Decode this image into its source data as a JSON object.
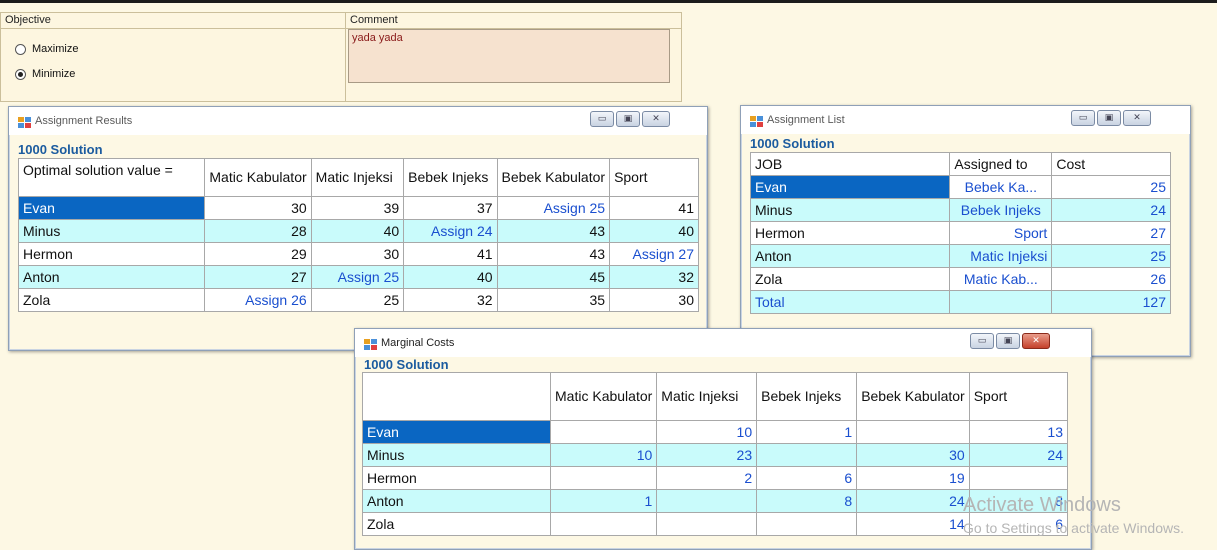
{
  "objective": {
    "label": "Objective",
    "maximize": "Maximize",
    "minimize": "Minimize",
    "selected": "minimize"
  },
  "comment": {
    "label": "Comment",
    "value": "yada yada"
  },
  "assignment_results": {
    "title": "Assignment Results",
    "solution": "1000 Solution",
    "corner": "Optimal solution value =",
    "columns": [
      "Matic Kabulator",
      "Matic Injeksi",
      "Bebek Injeks",
      "Bebek Kabulator",
      "Sport"
    ],
    "rows": [
      {
        "name": "Evan",
        "cells": [
          "30",
          "39",
          "37",
          "Assign 25",
          "41"
        ]
      },
      {
        "name": "Minus",
        "cells": [
          "28",
          "40",
          "Assign 24",
          "43",
          "40"
        ]
      },
      {
        "name": "Hermon",
        "cells": [
          "29",
          "30",
          "41",
          "43",
          "Assign 27"
        ]
      },
      {
        "name": "Anton",
        "cells": [
          "27",
          "Assign 25",
          "40",
          "45",
          "32"
        ]
      },
      {
        "name": "Zola",
        "cells": [
          "Assign 26",
          "25",
          "32",
          "35",
          "30"
        ]
      }
    ]
  },
  "assignment_list": {
    "title": "Assignment List",
    "solution": "1000 Solution",
    "columns": [
      "JOB",
      "Assigned to",
      "Cost"
    ],
    "rows": [
      {
        "job": "Evan",
        "assigned": "Bebek Ka...",
        "cost": "25"
      },
      {
        "job": "Minus",
        "assigned": "Bebek Injeks",
        "cost": "24"
      },
      {
        "job": "Hermon",
        "assigned": "Sport",
        "cost": "27"
      },
      {
        "job": "Anton",
        "assigned": "Matic Injeksi",
        "cost": "25"
      },
      {
        "job": "Zola",
        "assigned": "Matic Kab...",
        "cost": "26"
      },
      {
        "job": "Total",
        "assigned": "",
        "cost": "127"
      }
    ]
  },
  "marginal_costs": {
    "title": "Marginal Costs",
    "solution": "1000 Solution",
    "columns": [
      "Matic Kabulator",
      "Matic Injeksi",
      "Bebek Injeks",
      "Bebek Kabulator",
      "Sport"
    ],
    "rows": [
      {
        "name": "Evan",
        "cells": [
          "",
          "10",
          "1",
          "",
          "13"
        ]
      },
      {
        "name": "Minus",
        "cells": [
          "10",
          "23",
          "",
          "30",
          "24"
        ]
      },
      {
        "name": "Hermon",
        "cells": [
          "",
          "2",
          "6",
          "19",
          ""
        ]
      },
      {
        "name": "Anton",
        "cells": [
          "1",
          "",
          "8",
          "24",
          "8"
        ]
      },
      {
        "name": "Zola",
        "cells": [
          "",
          "",
          "",
          "14",
          "6"
        ]
      }
    ]
  },
  "watermark": {
    "line1": "Activate Windows",
    "line2": "Go to Settings to activate Windows."
  },
  "colors": {
    "selection": "#0a66c2",
    "alt_row": "#c9fbfb",
    "assign_text": "#1a4fcf",
    "solution_text": "#1b5b9f",
    "background": "#fdf8e4"
  }
}
